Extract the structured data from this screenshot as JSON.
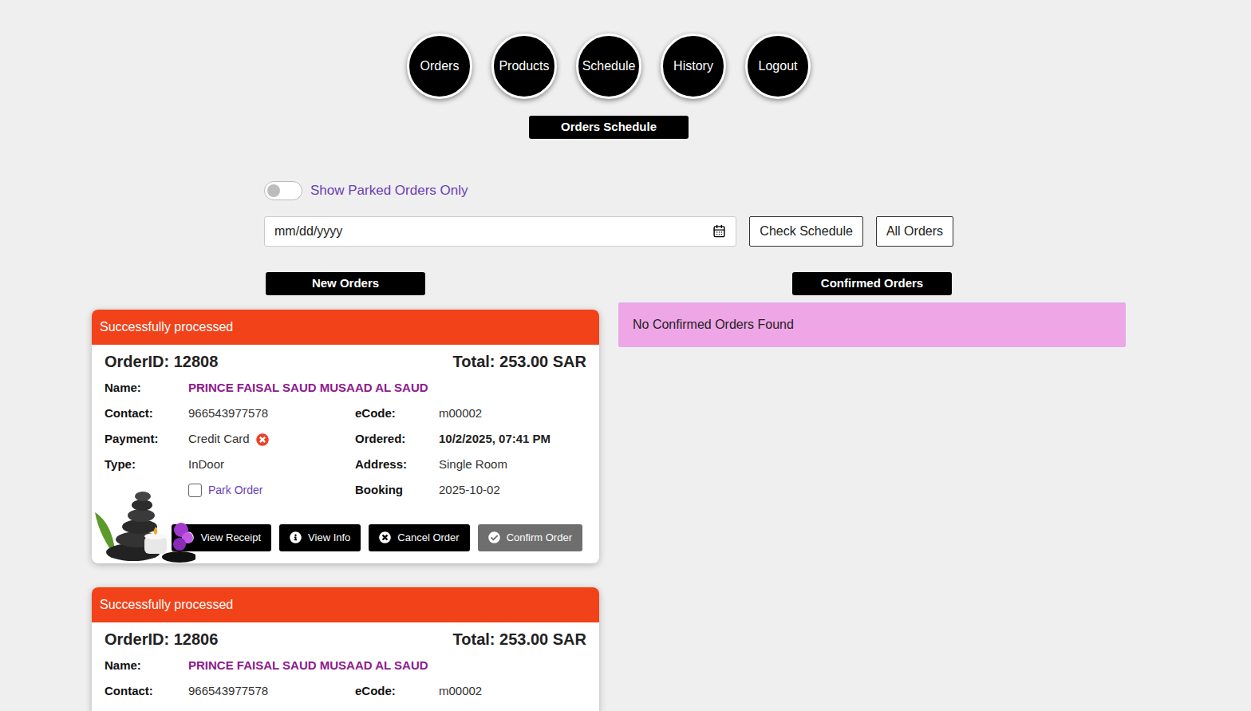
{
  "nav": [
    "Orders",
    "Products",
    "Schedule",
    "History",
    "Logout"
  ],
  "page_title": "Orders Schedule",
  "parked_toggle": {
    "label": "Show Parked Orders Only",
    "on": false
  },
  "date_input": {
    "placeholder": "mm/dd/yyyy"
  },
  "buttons": [
    "Check Schedule",
    "All Orders"
  ],
  "new_orders": {
    "title": "New Orders",
    "orders": [
      {
        "status": "Successfully processed",
        "order_id": "OrderID: 12808",
        "total": "Total: 253.00 SAR",
        "photo": true,
        "rows": [
          [
            {
              "kind": "name",
              "label": "Name:",
              "value": "PRINCE FAISAL SAUD MUSAAD AL SAUD"
            }
          ],
          [
            {
              "kind": "text",
              "label": "Contact:",
              "value": "966543977578"
            },
            {
              "kind": "text",
              "label": "eCode:",
              "value": "m00002"
            }
          ],
          [
            {
              "kind": "payment",
              "label": "Payment:",
              "value": "Credit Card",
              "paid": false
            },
            {
              "kind": "bold",
              "label": "Ordered:",
              "value": "10/2/2025, 07:41 PM"
            }
          ],
          [
            {
              "kind": "text",
              "label": "Type:",
              "value": "InDoor"
            },
            {
              "kind": "text",
              "label": "Address:",
              "value": "Single Room"
            }
          ],
          [
            {
              "kind": "park",
              "value": "Park Order",
              "checked": false
            },
            {
              "kind": "text",
              "label": "Booking",
              "value": "2025-10-02"
            }
          ]
        ],
        "actions": [
          {
            "label": "View Receipt",
            "kind": "info",
            "disabled": false
          },
          {
            "label": "View Info",
            "kind": "info",
            "disabled": false
          },
          {
            "label": "Cancel Order",
            "kind": "cancel",
            "disabled": false
          },
          {
            "label": "Confirm Order",
            "kind": "confirm",
            "disabled": true
          }
        ]
      },
      {
        "status": "Successfully processed",
        "order_id": "OrderID: 12806",
        "total": "Total: 253.00 SAR",
        "photo": false,
        "rows": [
          [
            {
              "kind": "name",
              "label": "Name:",
              "value": "PRINCE FAISAL SAUD MUSAAD AL SAUD"
            }
          ],
          [
            {
              "kind": "text",
              "label": "Contact:",
              "value": "966543977578"
            },
            {
              "kind": "text",
              "label": "eCode:",
              "value": "m00002"
            }
          ]
        ],
        "actions": []
      }
    ]
  },
  "confirmed_orders": {
    "title": "Confirmed Orders",
    "empty_message": "No Confirmed Orders Found"
  }
}
